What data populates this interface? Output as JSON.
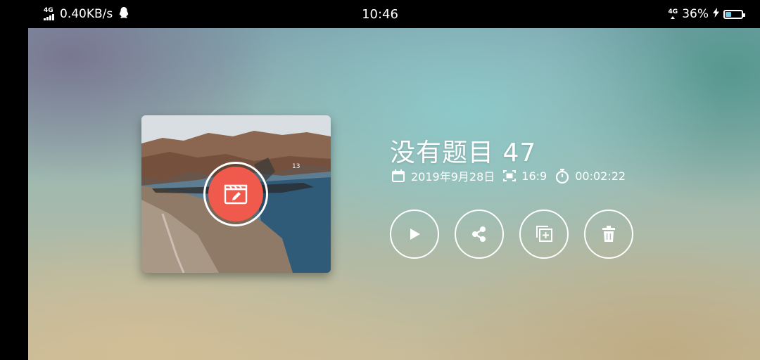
{
  "status_bar": {
    "network_type": "4G",
    "network_speed": "0.40KB/s",
    "time": "10:46",
    "right_network_type": "4G",
    "battery_percent": "36%",
    "battery_level": 0.36,
    "icons": [
      "signal-icon",
      "qq-icon",
      "wifi-4g-icon",
      "charging-icon",
      "battery-icon"
    ]
  },
  "project": {
    "title": "没有题目 47",
    "date": "2019年9月28日",
    "aspect_ratio": "16:9",
    "duration": "00:02:22",
    "thumbnail_overlay_text": "",
    "thumbnail_tag": "13"
  },
  "actions": [
    {
      "name": "play",
      "icon": "play-icon"
    },
    {
      "name": "share",
      "icon": "share-icon"
    },
    {
      "name": "duplicate",
      "icon": "duplicate-icon"
    },
    {
      "name": "delete",
      "icon": "trash-icon"
    }
  ],
  "colors": {
    "edit_button": "#f05a4c",
    "battery_fill": "#6fc7e0"
  }
}
